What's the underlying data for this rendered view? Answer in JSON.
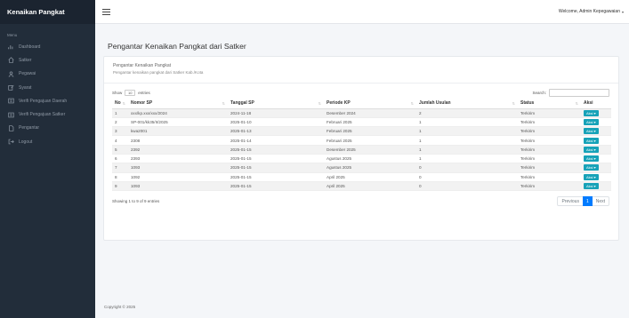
{
  "sidebar": {
    "brand": "Kenaikan Pangkat",
    "menu_label": "Menu",
    "items": [
      {
        "label": "Dashboard",
        "icon": "chart-icon"
      },
      {
        "label": "Satker",
        "icon": "home-icon"
      },
      {
        "label": "Pegawai",
        "icon": "user-icon"
      },
      {
        "label": "Syarat",
        "icon": "edit-icon"
      },
      {
        "label": "Verifi Pengajuan Daerah",
        "icon": "list-icon"
      },
      {
        "label": "Verifi Pengajuan Satker",
        "icon": "list-icon"
      },
      {
        "label": "Pengantar",
        "icon": "document-icon"
      },
      {
        "label": "Logout",
        "icon": "logout-icon"
      }
    ]
  },
  "topbar": {
    "welcome": "Welcome, Admin Kepegawaian"
  },
  "page": {
    "title": "Pengantar Kenaikan Pangkat dari Satker"
  },
  "card": {
    "title": "Pengantar Kenaikan Pangkat",
    "subtitle": "Pengantar kenaikan pangkat dari Satker Kab./Kota"
  },
  "datatable": {
    "show_label": "Show",
    "length_value": "10",
    "entries_label": "entries",
    "search_label": "Search:",
    "columns": [
      "No",
      "Nomor SP",
      "Tanggal SP",
      "Periode KP",
      "Jumlah Usulan",
      "Status",
      "Aksi"
    ],
    "rows": [
      [
        "1",
        "xxx/kp.xxx/xxx/2024",
        "2024-11-18",
        "Desember 2024",
        "2",
        "Terkirim",
        "Aksi"
      ],
      [
        "2",
        "SP-001/kk35/II/2025",
        "2025-01-10",
        "Februari 2025",
        "1",
        "Terkirim",
        "Aksi"
      ],
      [
        "3",
        "kwa2001",
        "2025-01-13",
        "Februari 2025",
        "1",
        "Terkirim",
        "Aksi"
      ],
      [
        "4",
        "2308",
        "2025-01-14",
        "Februari 2025",
        "1",
        "Terkirim",
        "Aksi"
      ],
      [
        "5",
        "2392",
        "2025-01-15",
        "Desember 2025",
        "1",
        "Terkirim",
        "Aksi"
      ],
      [
        "6",
        "2393",
        "2025-01-15",
        "Agustus 2025",
        "1",
        "Terkirim",
        "Aksi"
      ],
      [
        "7",
        "1093",
        "2025-01-15",
        "Agustus 2025",
        "0",
        "Terkirim",
        "Aksi"
      ],
      [
        "8",
        "1092",
        "2025-01-15",
        "April 2025",
        "0",
        "Terkirim",
        "Aksi"
      ],
      [
        "9",
        "1093",
        "2025-01-15",
        "April 2025",
        "0",
        "Terkirim",
        "Aksi"
      ]
    ],
    "info": "Showing 1 to 9 of 9 entries",
    "pager": {
      "previous": "Previous",
      "current": "1",
      "next": "Next"
    }
  },
  "footer": {
    "text": "Copyright © 2025"
  },
  "colors": {
    "sidebar_bg": "#222d3a",
    "accent": "#17a2b8",
    "pager_active": "#007bff"
  }
}
